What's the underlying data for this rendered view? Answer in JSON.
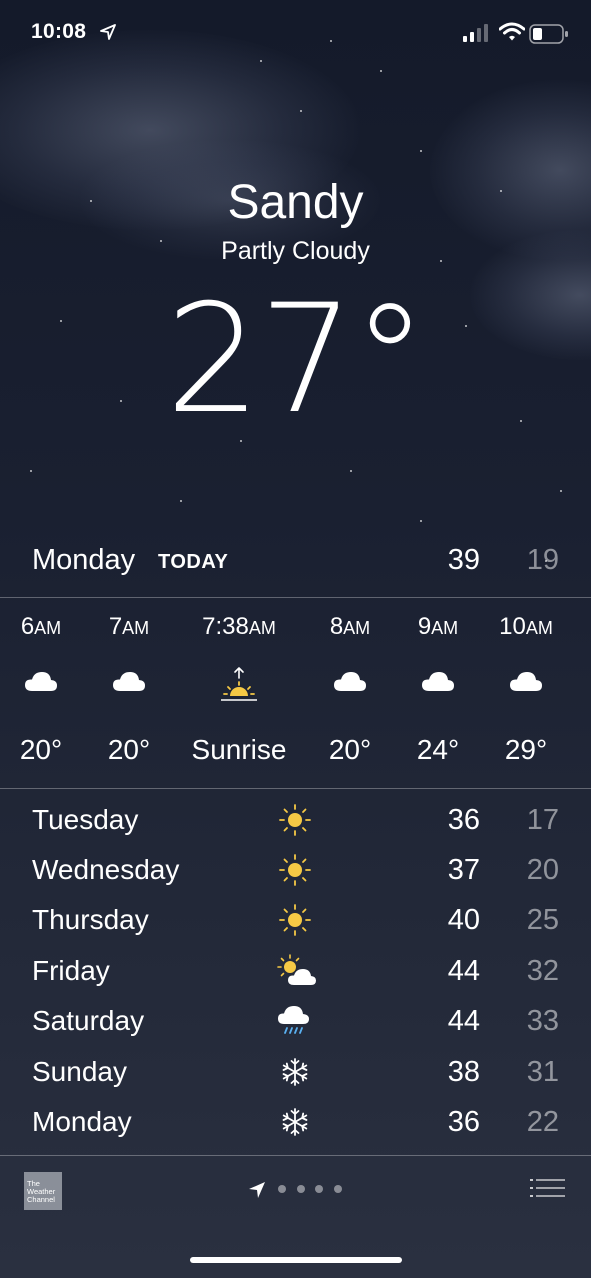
{
  "status_bar": {
    "time": "10:08"
  },
  "weather": {
    "city": "Sandy",
    "condition": "Partly Cloudy",
    "temperature": "27°"
  },
  "today": {
    "day": "Monday",
    "tag": "TODAY",
    "high": "39",
    "low": "19"
  },
  "hourly": [
    {
      "hour": "6",
      "suffix": "AM",
      "icon": "cloud-icon",
      "value": "20°"
    },
    {
      "hour": "7",
      "suffix": "AM",
      "icon": "cloud-icon",
      "value": "20°"
    },
    {
      "hour": "7:38",
      "suffix": "AM",
      "icon": "sunrise-icon",
      "value": "Sunrise"
    },
    {
      "hour": "8",
      "suffix": "AM",
      "icon": "cloud-icon",
      "value": "20°"
    },
    {
      "hour": "9",
      "suffix": "AM",
      "icon": "cloud-icon",
      "value": "24°"
    },
    {
      "hour": "10",
      "suffix": "AM",
      "icon": "cloud-icon",
      "value": "29°"
    }
  ],
  "daily": [
    {
      "day": "Tuesday",
      "icon": "sun-icon",
      "high": "36",
      "low": "17"
    },
    {
      "day": "Wednesday",
      "icon": "sun-icon",
      "high": "37",
      "low": "20"
    },
    {
      "day": "Thursday",
      "icon": "sun-icon",
      "high": "40",
      "low": "25"
    },
    {
      "day": "Friday",
      "icon": "partly-cloudy-icon",
      "high": "44",
      "low": "32"
    },
    {
      "day": "Saturday",
      "icon": "rain-icon",
      "high": "44",
      "low": "33"
    },
    {
      "day": "Sunday",
      "icon": "snowflake-icon",
      "high": "38",
      "low": "31"
    },
    {
      "day": "Monday",
      "icon": "snowflake-icon",
      "high": "36",
      "low": "22"
    }
  ],
  "toolbar": {
    "logo_text": "The Weather Channel",
    "page_count": 4
  },
  "colors": {
    "sun": "#f6c945",
    "rain": "#5ab0f0",
    "secondary_text": "#8c909a"
  }
}
